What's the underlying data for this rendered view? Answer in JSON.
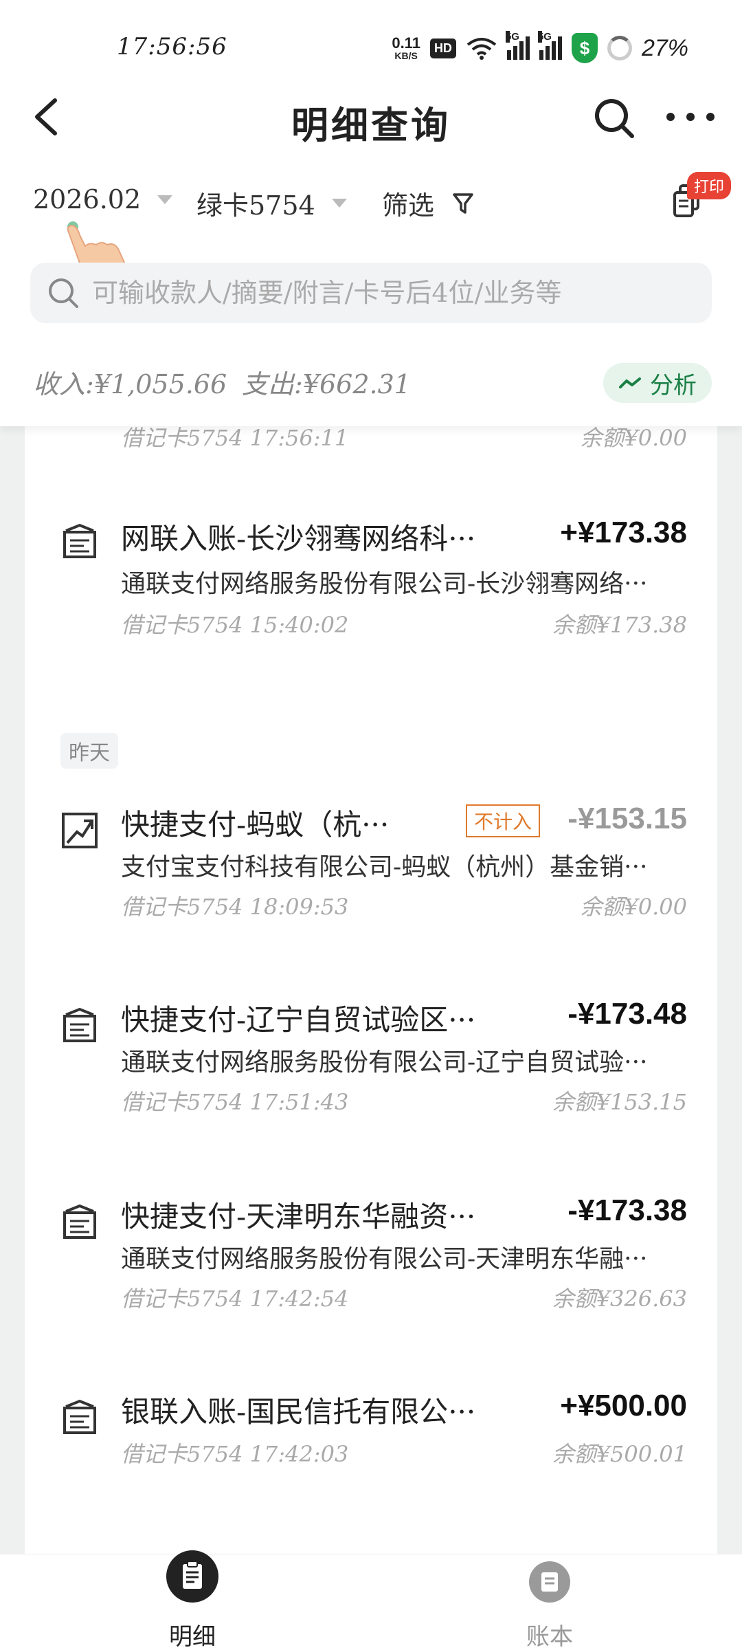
{
  "status_bar": {
    "time": "17:56:56",
    "net_speed": "0.11",
    "net_unit": "KB/S",
    "hd": "HD",
    "signal1": "5G",
    "signal2": "5G",
    "battery": "27%"
  },
  "header": {
    "title": "明细查询"
  },
  "filters": {
    "month": "2026.02",
    "card": "绿卡5754",
    "filter_label": "筛选",
    "print_badge": "打印"
  },
  "search": {
    "placeholder": "可输收款人/摘要/附言/卡号后4位/业务等"
  },
  "summary": {
    "income": "收入:¥1,055.66",
    "expense": "支出:¥662.31",
    "analyze_label": "分析"
  },
  "colors": {
    "accent_green": "#1a7f44",
    "exclude_orange": "#e07a2c",
    "badge_red": "#e84235"
  },
  "transactions_today": [
    {
      "meta": "借记卡5754 17:56:11",
      "balance": "余额¥0.00"
    },
    {
      "icon": "bank-receipt-icon",
      "title": "网联入账-长沙翎骞网络科···",
      "amount": "+¥173.38",
      "desc": "通联支付网络服务股份有限公司-长沙翎骞网络···",
      "meta": "借记卡5754 15:40:02",
      "balance": "余额¥173.38"
    }
  ],
  "day_label": "昨天",
  "transactions_yesterday": [
    {
      "icon": "transfer-out-icon",
      "title": "快捷支付-蚂蚁（杭···",
      "tag": "不计入",
      "amount": "-¥153.15",
      "desc": "支付宝支付科技有限公司-蚂蚁（杭州）基金销···",
      "meta": "借记卡5754 18:09:53",
      "balance": "余额¥0.00"
    },
    {
      "icon": "bank-receipt-icon",
      "title": "快捷支付-辽宁自贸试验区···",
      "amount": "-¥173.48",
      "desc": "通联支付网络服务股份有限公司-辽宁自贸试验···",
      "meta": "借记卡5754 17:51:43",
      "balance": "余额¥153.15"
    },
    {
      "icon": "bank-receipt-icon",
      "title": "快捷支付-天津明东华融资···",
      "amount": "-¥173.38",
      "desc": "通联支付网络服务股份有限公司-天津明东华融···",
      "meta": "借记卡5754 17:42:54",
      "balance": "余额¥326.63"
    },
    {
      "icon": "bank-receipt-icon",
      "title": "银联入账-国民信托有限公···",
      "amount": "+¥500.00",
      "meta": "借记卡5754 17:42:03",
      "balance": "余额¥500.01"
    }
  ],
  "bottom_nav": [
    {
      "label": "明细",
      "icon": "document-icon",
      "active": true
    },
    {
      "label": "账本",
      "icon": "ledger-icon",
      "active": false
    }
  ]
}
